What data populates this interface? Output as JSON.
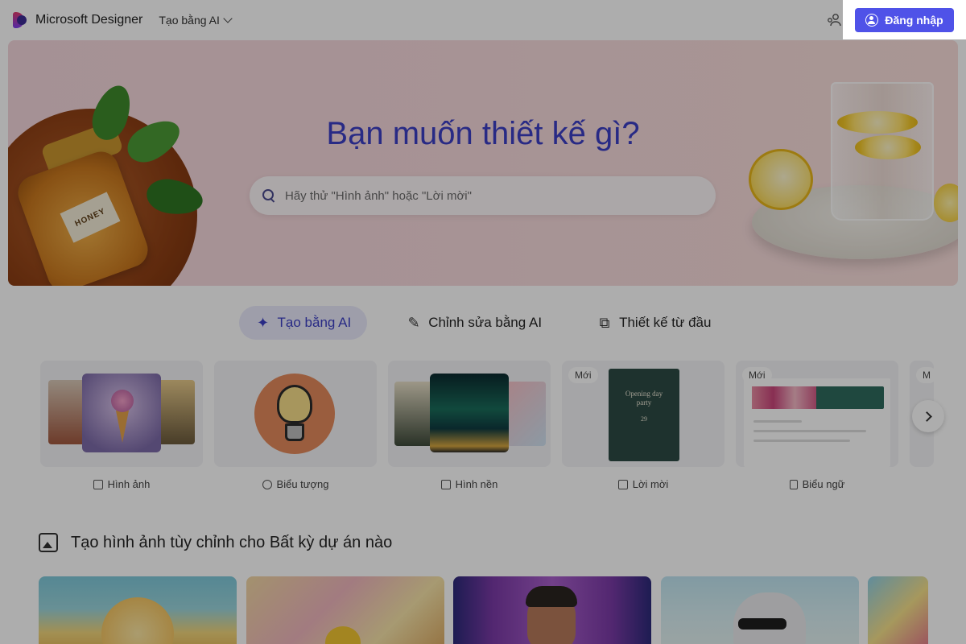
{
  "header": {
    "brand": "Microsoft Designer",
    "mode_label": "Tạo bằng AI",
    "signin_label": "Đăng nhập"
  },
  "hero": {
    "title": "Bạn muốn thiết kế gì?",
    "search_placeholder": "Hãy thử \"Hình ảnh\" hoặc \"Lời mời\"",
    "search_value": "",
    "jar_label": "HONEY"
  },
  "tabs": [
    {
      "label": "Tạo bằng AI",
      "icon": "sparkle-icon",
      "active": true
    },
    {
      "label": "Chỉnh sửa bằng AI",
      "icon": "edit-sparkle-icon",
      "active": false
    },
    {
      "label": "Thiết kế từ đầu",
      "icon": "shapes-icon",
      "active": false
    }
  ],
  "templates": [
    {
      "label": "Hình ảnh",
      "icon": "image-sparkle-icon",
      "badge": ""
    },
    {
      "label": "Biểu tượng",
      "icon": "sticker-icon",
      "badge": ""
    },
    {
      "label": "Hình nền",
      "icon": "wallpaper-icon",
      "badge": ""
    },
    {
      "label": "Lời mời",
      "icon": "calendar-icon",
      "badge": "Mới",
      "card_line1": "Opening day",
      "card_line2": "party",
      "card_date": "29"
    },
    {
      "label": "Biểu ngữ",
      "icon": "clipboard-icon",
      "badge": "Mới"
    },
    {
      "label": "",
      "icon": "",
      "badge": "M"
    }
  ],
  "section": {
    "title": "Tạo hình ảnh tùy chỉnh cho Bất kỳ dự án nào"
  },
  "colors": {
    "accent": "#4f52e8",
    "title_blue": "#3b3fc4",
    "active_tab_bg": "#e9e9fb"
  }
}
